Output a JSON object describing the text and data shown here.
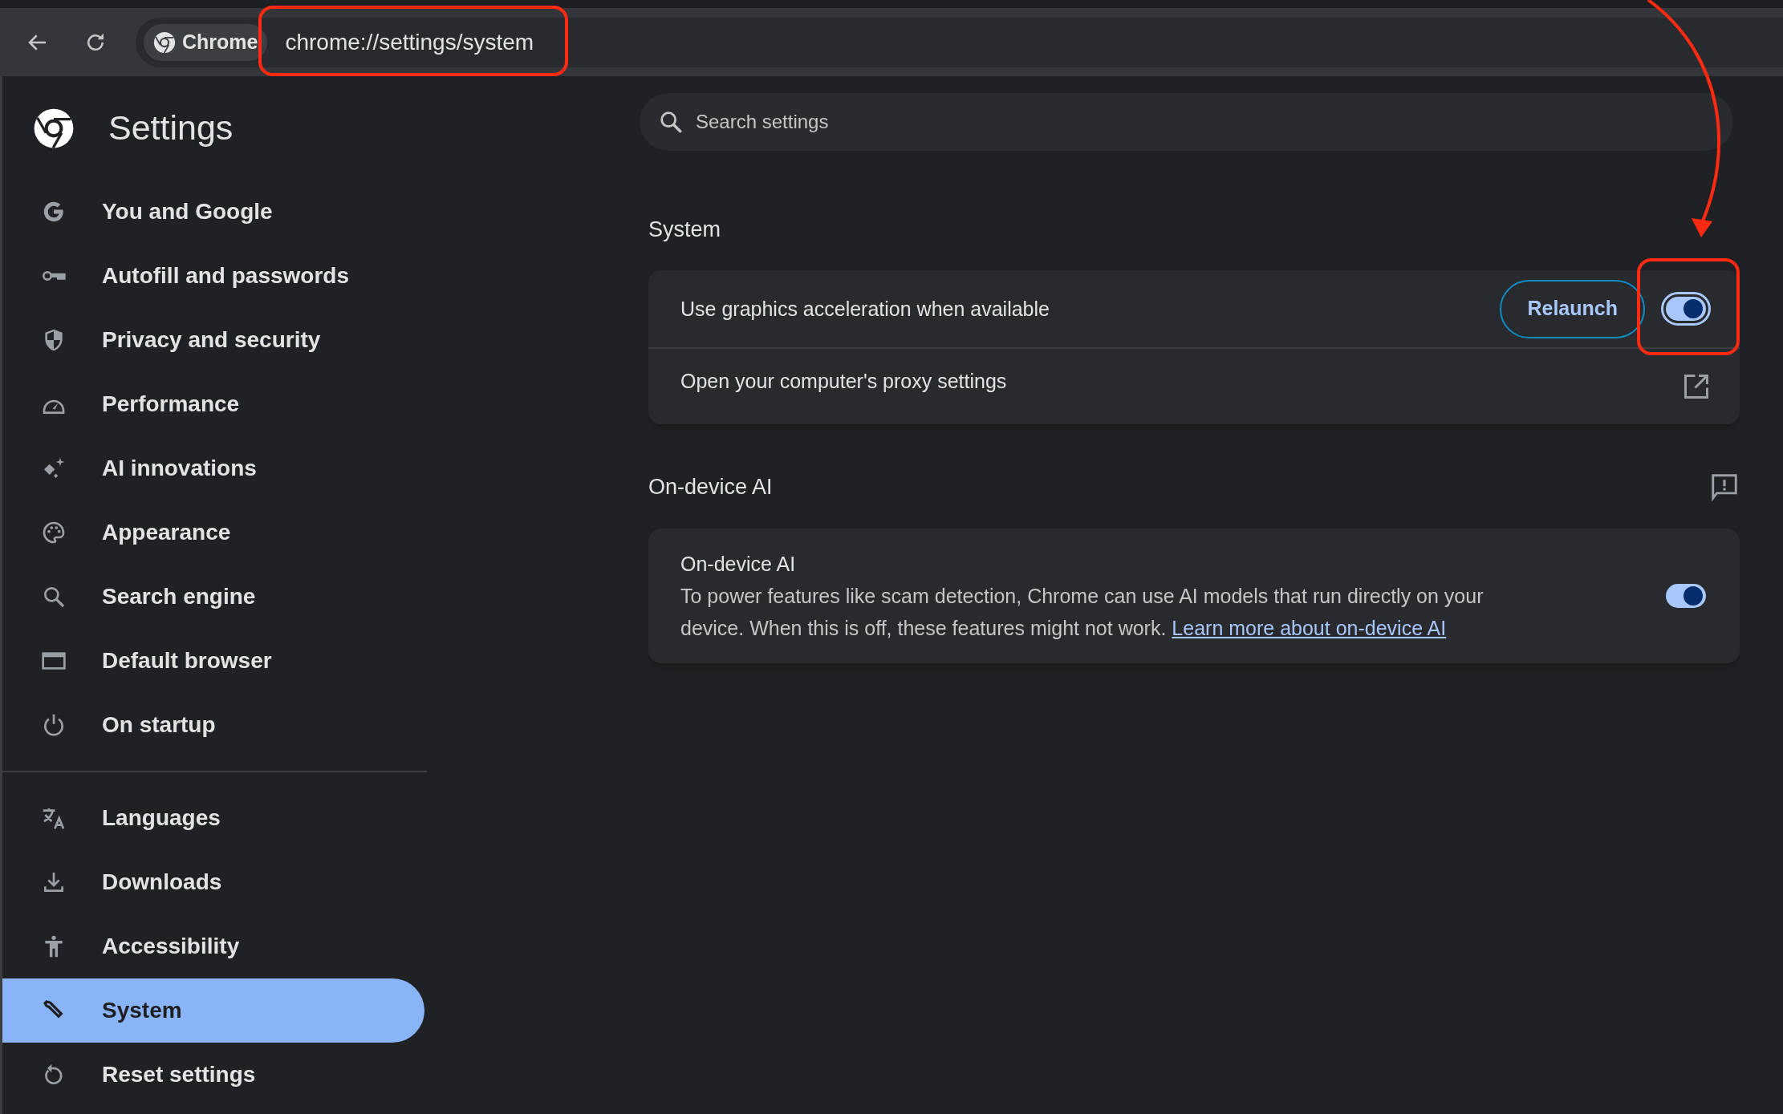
{
  "toolbar": {
    "tab_chip": {
      "label": "Chrome"
    },
    "address_bar": {
      "url": "chrome://settings/system"
    }
  },
  "sidebar": {
    "title": "Settings",
    "groups": [
      {
        "items": [
          {
            "label": "You and Google",
            "selected": false
          },
          {
            "label": "Autofill and passwords",
            "selected": false
          },
          {
            "label": "Privacy and security",
            "selected": false
          },
          {
            "label": "Performance",
            "selected": false
          },
          {
            "label": "AI innovations",
            "selected": false
          },
          {
            "label": "Appearance",
            "selected": false
          },
          {
            "label": "Search engine",
            "selected": false
          },
          {
            "label": "Default browser",
            "selected": false
          },
          {
            "label": "On startup",
            "selected": false
          }
        ]
      },
      {
        "items": [
          {
            "label": "Languages",
            "selected": false
          },
          {
            "label": "Downloads",
            "selected": false
          },
          {
            "label": "Accessibility",
            "selected": false
          },
          {
            "label": "System",
            "selected": true
          },
          {
            "label": "Reset settings",
            "selected": false
          }
        ]
      }
    ]
  },
  "search": {
    "placeholder": "Search settings"
  },
  "sections": [
    {
      "title": "System",
      "rows": [
        {
          "kind": "toggle",
          "label": "Use graphics acceleration when available",
          "button": "Relaunch",
          "on": true,
          "focused": true
        },
        {
          "kind": "link",
          "label": "Open your computer's proxy settings"
        }
      ]
    },
    {
      "title": "On-device AI",
      "rows": [
        {
          "kind": "toggle",
          "label": "On-device AI",
          "description": "To power features like scam detection, Chrome can use AI models that run directly on your device. When this is off, these features might not work.",
          "link": "Learn more about on-device AI",
          "on": true,
          "focused": false
        }
      ]
    }
  ]
}
